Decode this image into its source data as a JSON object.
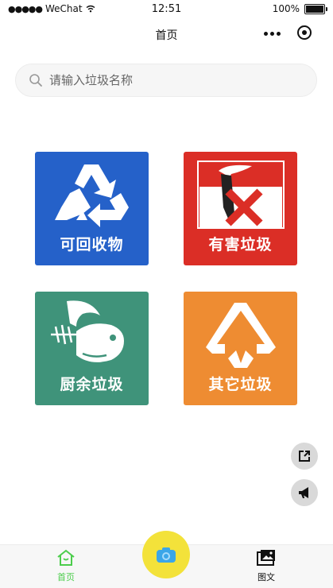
{
  "status_bar": {
    "carrier": "WeChat",
    "time": "12:51",
    "battery": "100%"
  },
  "nav": {
    "title": "首页"
  },
  "search": {
    "placeholder": "请输入垃圾名称"
  },
  "categories": [
    {
      "label": "可回收物",
      "color": "#2561c9",
      "icon": "recycle-icon"
    },
    {
      "label": "有害垃圾",
      "color": "#db2e26",
      "icon": "hazardous-icon"
    },
    {
      "label": "厨余垃圾",
      "color": "#3f937a",
      "icon": "fishbone-icon"
    },
    {
      "label": "其它垃圾",
      "color": "#ee8c32",
      "icon": "other-waste-icon"
    }
  ],
  "tab_bar": {
    "items": [
      {
        "label": "首页",
        "icon": "home-icon",
        "color": "#4ccd4c"
      },
      {
        "label": "",
        "icon": "camera-icon",
        "color": "#f3e23a"
      },
      {
        "label": "图文",
        "icon": "image-text-icon",
        "color": "#111111"
      }
    ]
  },
  "floating_buttons": [
    {
      "icon": "share-icon"
    },
    {
      "icon": "megaphone-icon"
    }
  ]
}
